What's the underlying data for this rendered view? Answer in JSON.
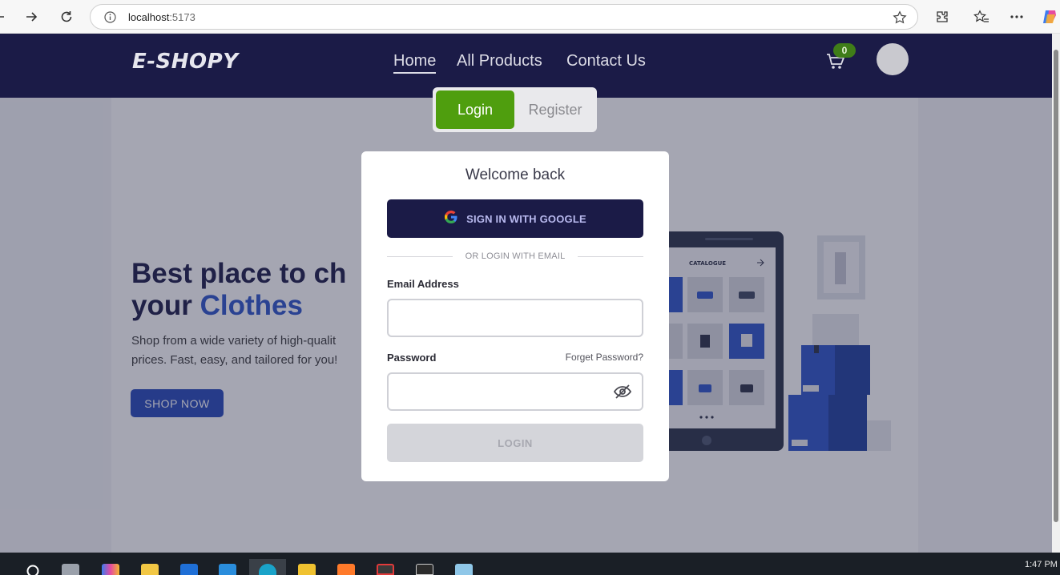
{
  "browser": {
    "url_host": "localhost",
    "url_port": ":5173",
    "icons": [
      "back-arrow-icon",
      "forward-arrow-icon",
      "reload-icon",
      "site-info-icon",
      "favorite-star-icon",
      "extensions-icon",
      "favorites-icon",
      "more-icon",
      "copilot-icon"
    ]
  },
  "navbar": {
    "logo": "E-SHOPY",
    "links": [
      "Home",
      "All Products",
      "Contact Us"
    ],
    "active_link": "Home",
    "cart_count": "0"
  },
  "hero": {
    "title_line1": "Best place to ch",
    "title_line2_prefix": "your ",
    "title_accent": "Clothes",
    "subtitle_line1": "Shop from a wide variety of high-qualit",
    "subtitle_line2": "prices. Fast, easy, and tailored for you!",
    "cta": "SHOP NOW",
    "illustration_label": "CATALOGUE"
  },
  "auth_tabs": {
    "login": "Login",
    "register": "Register",
    "active": "Login"
  },
  "modal": {
    "title": "Welcome back",
    "google_button": "SIGN IN WITH GOOGLE",
    "divider_text": "OR LOGIN WITH EMAIL",
    "email_label": "Email Address",
    "email_value": "",
    "password_label": "Password",
    "password_value": "",
    "forgot_password": "Forget Password?",
    "submit": "LOGIN"
  },
  "colors": {
    "navbar": "#1b1b47",
    "accent_blue": "#2c54c9",
    "login_tab_green": "#4f9e0e",
    "google_button_bg": "#1b1b47",
    "disabled_button": "#d4d5da"
  },
  "taskbar": {
    "time": "1:47 PM"
  }
}
